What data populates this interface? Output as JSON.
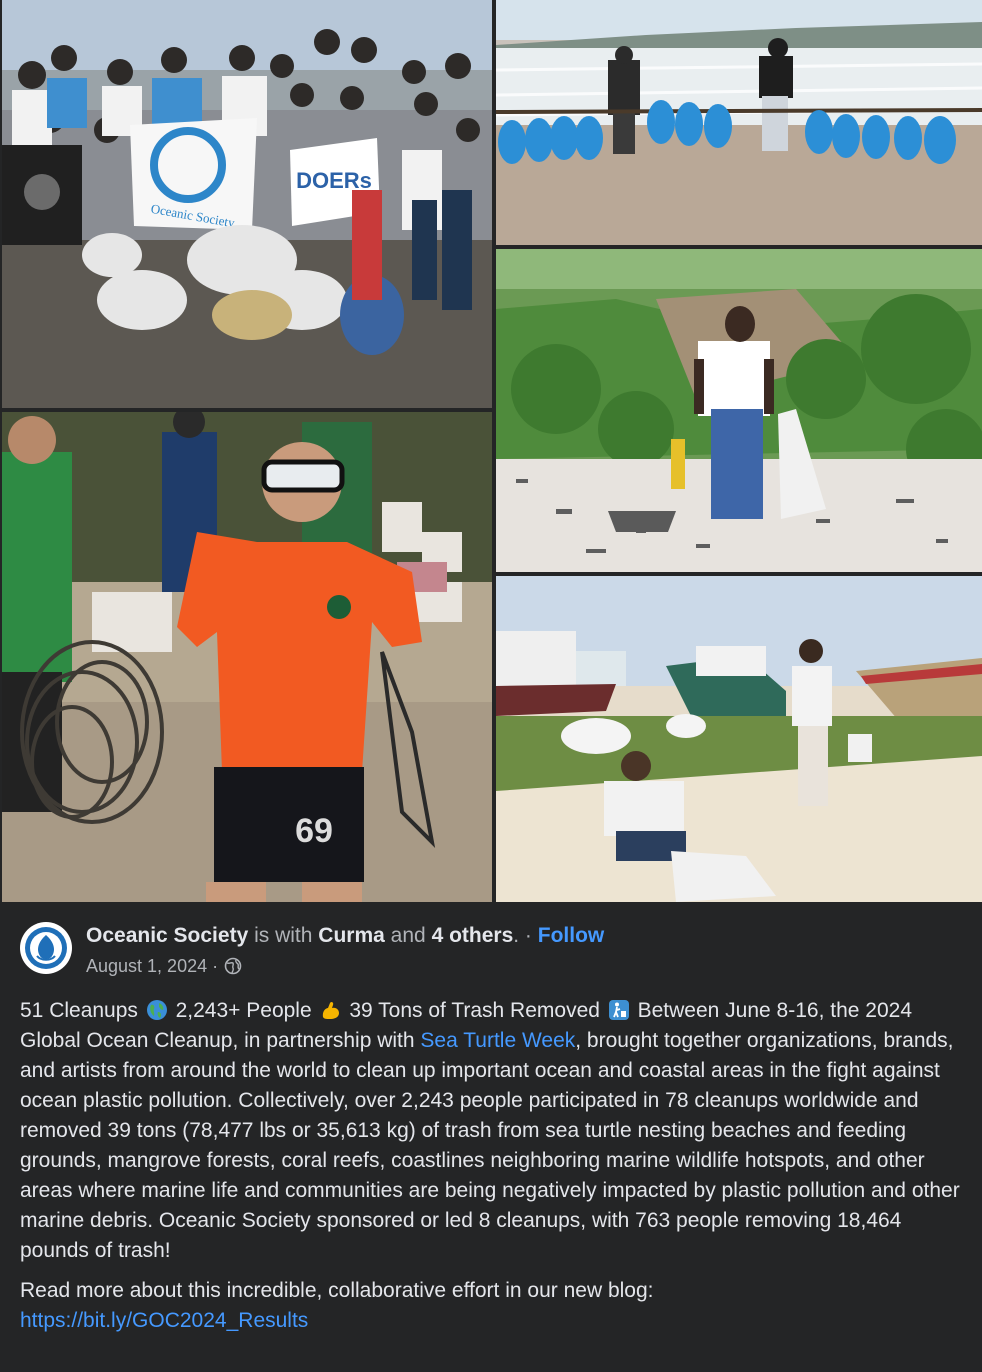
{
  "post": {
    "author": "Oceanic Society",
    "with_text": "is with",
    "tagged": "Curma",
    "and_text": "and",
    "others": "4 others",
    "follow_label": "Follow",
    "date": "August 1, 2024",
    "audience_icon": "globe-icon",
    "stat_cleanups": "51 Cleanups",
    "stat_people": "2,243+ People",
    "stat_tons": "39 Tons of Trash Removed",
    "text_a": "Between June 8-16, the 2024 Global Ocean Cleanup, in partnership with",
    "partner_link": "Sea Turtle Week",
    "text_b": ", brought together organizations, brands, and artists from around the world to clean up important ocean and coastal areas in the fight against ocean plastic pollution. Collectively, over 2,243 people participated in 78 cleanups worldwide and removed 39 tons (78,477 lbs or 35,613 kg) of trash from sea turtle nesting beaches and feeding grounds, mangrove forests, coral reefs, coastlines neighboring marine wildlife hotspots, and other areas where marine life and communities are being negatively impacted by plastic pollution and other marine debris. Oceanic Society sponsored or led 8 cleanups, with 763 people removing 18,464 pounds of trash!",
    "read_more": "Read more about this incredible, collaborative effort in our new blog:",
    "blog_link": "https://bit.ly/GOC2024_Results"
  },
  "photos": [
    {
      "name": "group-photo-with-banners",
      "banner_1": "Oceanic Society",
      "banner_2": "DOERs"
    },
    {
      "name": "beach-bag-carry-photo"
    },
    {
      "name": "woman-collecting-trash-photo"
    },
    {
      "name": "snorkeler-holding-net-photo",
      "shirt_number": "69"
    },
    {
      "name": "boats-beach-cleanup-photo"
    }
  ],
  "colors": {
    "background": "#242526",
    "link": "#4599ff",
    "text": "#e4e6eb",
    "muted": "#b0b3b8"
  }
}
